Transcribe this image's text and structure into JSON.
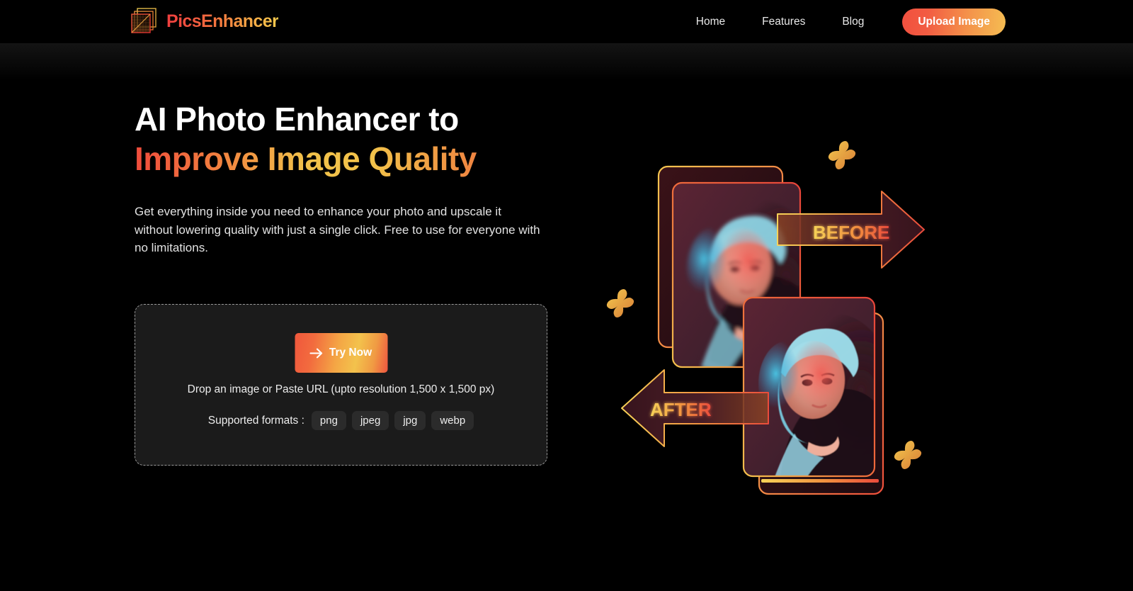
{
  "theme": {
    "background": "#000000",
    "card_background": "#1b1b1b",
    "text_primary": "#ffffff",
    "text_secondary": "#e3e3e3",
    "accent_red": "#ef4b3c",
    "accent_orange": "#f2813f",
    "accent_yellow": "#f2c24a",
    "dashed_border": "#9a9a9a"
  },
  "header": {
    "logo_icon": "stacked-frames-icon",
    "brand_name": "PicsEnhancer",
    "nav": [
      {
        "label": "Home",
        "name": "nav-link-home"
      },
      {
        "label": "Features",
        "name": "nav-link-features"
      },
      {
        "label": "Blog",
        "name": "nav-link-blog"
      }
    ],
    "cta_label": "Upload Image"
  },
  "hero": {
    "headline_line1": "AI Photo Enhancer to",
    "headline_line2": "Improve Image Quality",
    "subtext": "Get everything inside you need to enhance your photo and upscale it without lowering quality with just a single click. Free to use for everyone with no limitations."
  },
  "dropzone": {
    "try_button_label": "Try Now",
    "try_button_icon": "arrow-right-icon",
    "drop_hint": "Drop an image or Paste URL (upto resolution 1,500 x 1,500 px)",
    "formats_label": "Supported formats :",
    "formats": [
      "png",
      "jpeg",
      "jpg",
      "webp"
    ]
  },
  "illustration": {
    "before_label": "BEFORE",
    "after_label": "AFTER",
    "sparkle_count": 3,
    "card_count": 4
  }
}
